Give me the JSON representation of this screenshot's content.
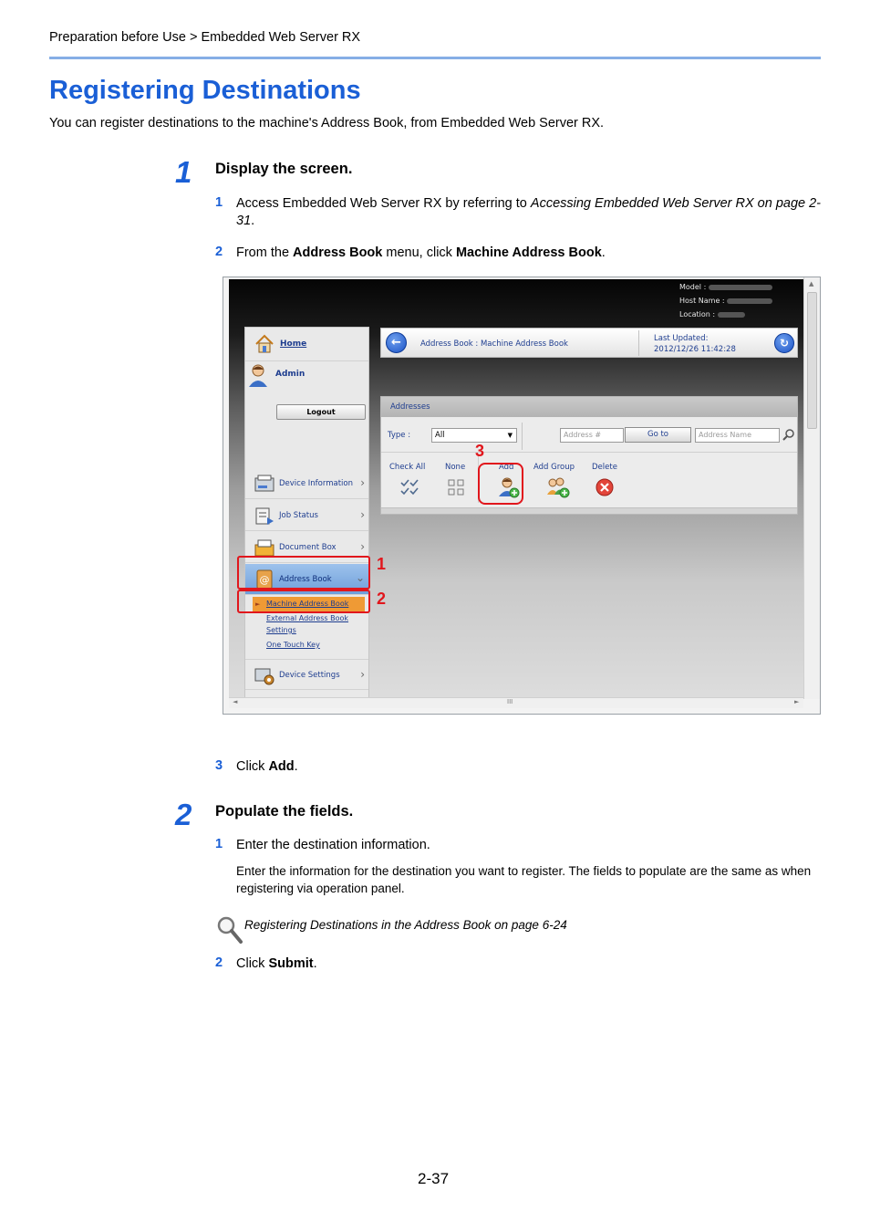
{
  "header": {
    "breadcrumb": "Preparation before Use > Embedded Web Server RX",
    "title": "Registering Destinations",
    "intro": "You can register destinations to the machine's Address Book, from Embedded Web Server RX."
  },
  "steps": [
    {
      "number": "1",
      "heading": "Display the screen.",
      "substeps": [
        {
          "number": "1",
          "text_plain": "Access Embedded Web Server RX by referring to ",
          "text_italic": "Accessing Embedded Web Server RX on page 2-31",
          "text_end": "."
        },
        {
          "number": "2",
          "text_a": "From the ",
          "bold_a": "Address Book",
          "text_b": " menu, click ",
          "bold_b": "Machine Address Book",
          "text_end": "."
        },
        {
          "number": "3",
          "text_a": "Click ",
          "bold_a": "Add",
          "text_end": "."
        }
      ]
    },
    {
      "number": "2",
      "heading": "Populate the fields.",
      "substeps": [
        {
          "number": "1",
          "text": "Enter the destination information.",
          "note": "Enter the information for the destination you want to register. The fields to populate are the same as when registering via operation panel."
        },
        {
          "number": "2",
          "text_a": "Click ",
          "bold_a": "Submit",
          "text_end": "."
        }
      ],
      "reference": "Registering Destinations in the Address Book on page 6-24"
    }
  ],
  "screenshot": {
    "info": {
      "model": "Model :",
      "host": "Host Name :",
      "location": "Location :"
    },
    "left_menu": {
      "home": "Home",
      "admin": "Admin",
      "logout": "Logout",
      "items": [
        "Device Information",
        "Job Status",
        "Document Box",
        "Address Book"
      ],
      "submenu": [
        "Machine Address Book",
        "External Address Book",
        "Settings",
        "One Touch Key"
      ],
      "device_settings": "Device Settings"
    },
    "topbar": {
      "breadcrumb": "Address Book : Machine Address Book",
      "last_updated_label": "Last Updated:",
      "last_updated_value": "2012/12/26 11:42:28"
    },
    "panel": {
      "title": "Addresses",
      "type_label": "Type :",
      "type_value": "All",
      "address_placeholder": "Address #",
      "go_to": "Go to",
      "name_placeholder": "Address Name",
      "actions": [
        "Check All",
        "None",
        "Add",
        "Add Group",
        "Delete"
      ]
    },
    "callouts": [
      "1",
      "2",
      "3"
    ],
    "scroll_grip": "III"
  },
  "footer": {
    "page_number": "2-37"
  },
  "colors": {
    "accent": "#1a5fd6",
    "callout": "#e1161c",
    "menu_highlight": "#ef9a35"
  }
}
